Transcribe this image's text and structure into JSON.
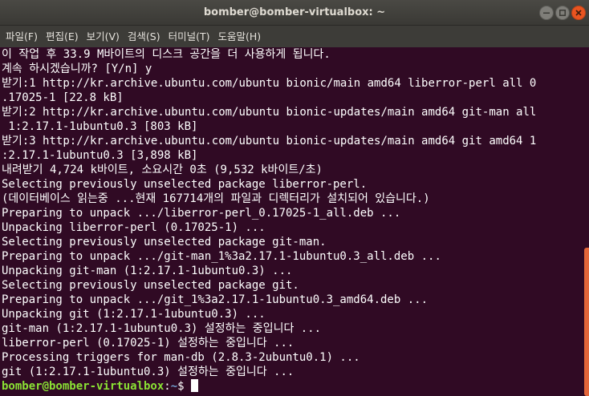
{
  "window": {
    "title": "bomber@bomber-virtualbox: ~"
  },
  "menu": [
    "파일(F)",
    "편집(E)",
    "보기(V)",
    "검색(S)",
    "터미널(T)",
    "도움말(H)"
  ],
  "terminal": {
    "lines": [
      "이 작업 후 33.9 M바이트의 디스크 공간을 더 사용하게 됩니다.",
      "계속 하시겠습니까? [Y/n] y",
      "받기:1 http://kr.archive.ubuntu.com/ubuntu bionic/main amd64 liberror-perl all 0",
      ".17025-1 [22.8 kB]",
      "받기:2 http://kr.archive.ubuntu.com/ubuntu bionic-updates/main amd64 git-man all",
      " 1:2.17.1-1ubuntu0.3 [803 kB]",
      "받기:3 http://kr.archive.ubuntu.com/ubuntu bionic-updates/main amd64 git amd64 1",
      ":2.17.1-1ubuntu0.3 [3,898 kB]",
      "내려받기 4,724 k바이트, 소요시간 0초 (9,532 k바이트/초)",
      "Selecting previously unselected package liberror-perl.",
      "(데이터베이스 읽는중 ...현재 167714개의 파일과 디렉터리가 설치되어 있습니다.)",
      "Preparing to unpack .../liberror-perl_0.17025-1_all.deb ...",
      "Unpacking liberror-perl (0.17025-1) ...",
      "Selecting previously unselected package git-man.",
      "Preparing to unpack .../git-man_1%3a2.17.1-1ubuntu0.3_all.deb ...",
      "Unpacking git-man (1:2.17.1-1ubuntu0.3) ...",
      "Selecting previously unselected package git.",
      "Preparing to unpack .../git_1%3a2.17.1-1ubuntu0.3_amd64.deb ...",
      "Unpacking git (1:2.17.1-1ubuntu0.3) ...",
      "git-man (1:2.17.1-1ubuntu0.3) 설정하는 중입니다 ...",
      "liberror-perl (0.17025-1) 설정하는 중입니다 ...",
      "Processing triggers for man-db (2.8.3-2ubuntu0.1) ...",
      "git (1:2.17.1-1ubuntu0.3) 설정하는 중입니다 ..."
    ],
    "prompt": {
      "user_host": "bomber@bomber-virtualbox",
      "separator": ":",
      "path": "~",
      "symbol": "$ "
    }
  },
  "colors": {
    "background": "#300a24",
    "prompt_user": "#8ae234",
    "prompt_path": "#729fcf",
    "scroll_thumb": "#e2663a",
    "close_button": "#e95420"
  },
  "icons": {
    "minimize": "minimize-icon",
    "maximize": "maximize-icon",
    "close": "close-icon"
  }
}
